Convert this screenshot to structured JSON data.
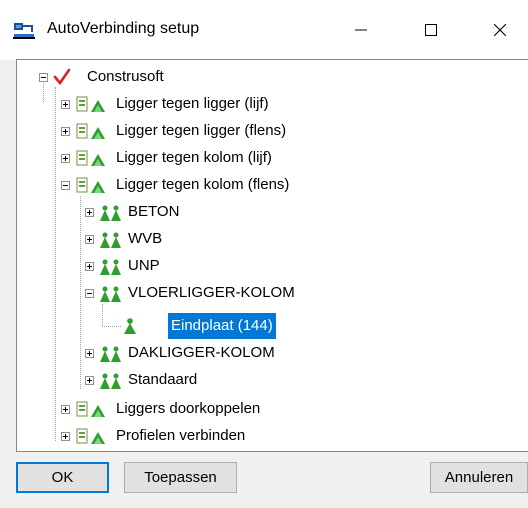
{
  "window": {
    "title": "AutoVerbinding setup",
    "minimize_icon": "minimize-icon",
    "maximize_icon": "maximize-icon",
    "close_icon": "close-icon"
  },
  "tree": {
    "root": {
      "label": "Construsoft",
      "expanded": true,
      "icon": "red-checkmark-icon"
    },
    "groups": [
      {
        "label": "Ligger tegen ligger (lijf)",
        "expanded": false,
        "icon": "rule-group-icon"
      },
      {
        "label": "Ligger tegen ligger (flens)",
        "expanded": false,
        "icon": "rule-group-icon"
      },
      {
        "label": "Ligger tegen kolom (lijf)",
        "expanded": false,
        "icon": "rule-group-icon"
      },
      {
        "label": "Ligger tegen kolom (flens)",
        "expanded": true,
        "icon": "rule-group-icon"
      },
      {
        "label": "Liggers doorkoppelen",
        "expanded": false,
        "icon": "rule-group-icon"
      },
      {
        "label": "Profielen verbinden",
        "expanded": false,
        "icon": "rule-group-icon"
      }
    ],
    "rule_sets": [
      {
        "label": "BETON",
        "expanded": false,
        "icon": "green-ruleset-icon"
      },
      {
        "label": "WVB",
        "expanded": false,
        "icon": "green-ruleset-icon"
      },
      {
        "label": "UNP",
        "expanded": false,
        "icon": "green-ruleset-icon"
      },
      {
        "label": "VLOERLIGGER-KOLOM",
        "expanded": true,
        "icon": "green-ruleset-icon"
      },
      {
        "label": "DAKLIGGER-KOLOM",
        "expanded": false,
        "icon": "green-ruleset-icon"
      },
      {
        "label": "Standaard",
        "expanded": false,
        "icon": "green-ruleset-icon"
      }
    ],
    "leaf": {
      "label": "Eindplaat (144)",
      "selected": true,
      "icon": "green-rule-icon"
    }
  },
  "buttons": {
    "ok": "OK",
    "apply": "Toepassen",
    "cancel": "Annuleren"
  },
  "colors": {
    "selection": "#0078d7",
    "button_face": "#e1e1e1",
    "dialog_background": "#f0f0f0"
  }
}
